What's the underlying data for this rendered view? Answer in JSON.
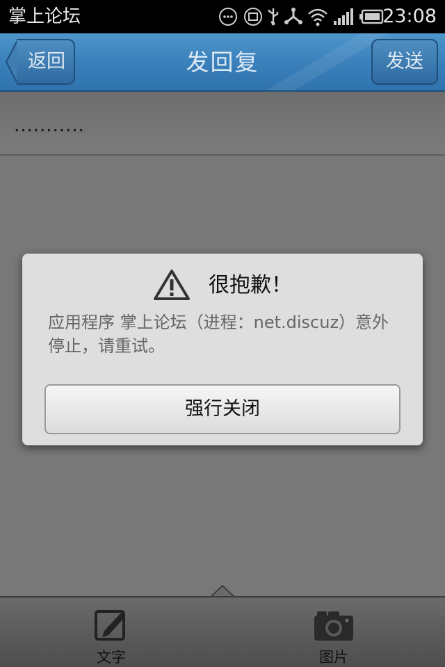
{
  "status_bar": {
    "app_name": "掌上论坛",
    "time": "23:08"
  },
  "header": {
    "back_label": "返回",
    "title": "发回复",
    "send_label": "发送"
  },
  "reply": {
    "text": "..........."
  },
  "dialog": {
    "title": "很抱歉！",
    "message": "应用程序 掌上论坛（进程：net.discuz）意外停止，请重试。",
    "button_label": "强行关闭"
  },
  "toolbar": {
    "text_label": "文字",
    "image_label": "图片"
  },
  "icons": {
    "back": "arrow-left",
    "warning": "warning-triangle",
    "text_tool": "pencil-square",
    "image_tool": "camera"
  },
  "colors": {
    "header_blue": "#3a80bb",
    "dim_overlay": "#787878",
    "dialog_bg": "#dedede"
  }
}
